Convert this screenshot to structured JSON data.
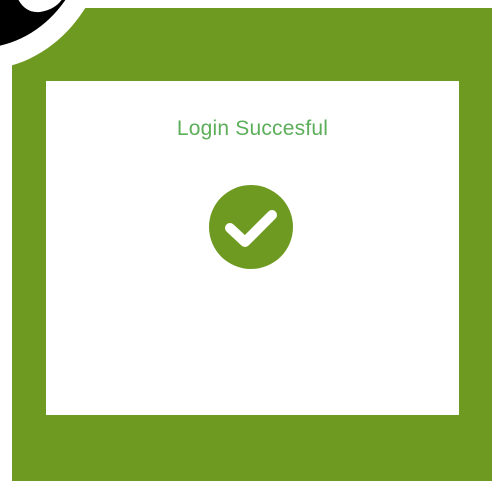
{
  "dialog": {
    "title": "Login Succesful",
    "icon": "checkmark-circle-icon"
  },
  "colors": {
    "panel_background": "#6f9a21",
    "dialog_background": "#ffffff",
    "title_text": "#5cae5a",
    "icon_fill": "#6f9a21"
  },
  "decorations": {
    "corner_badge_icon": "partial-logo-badge"
  }
}
